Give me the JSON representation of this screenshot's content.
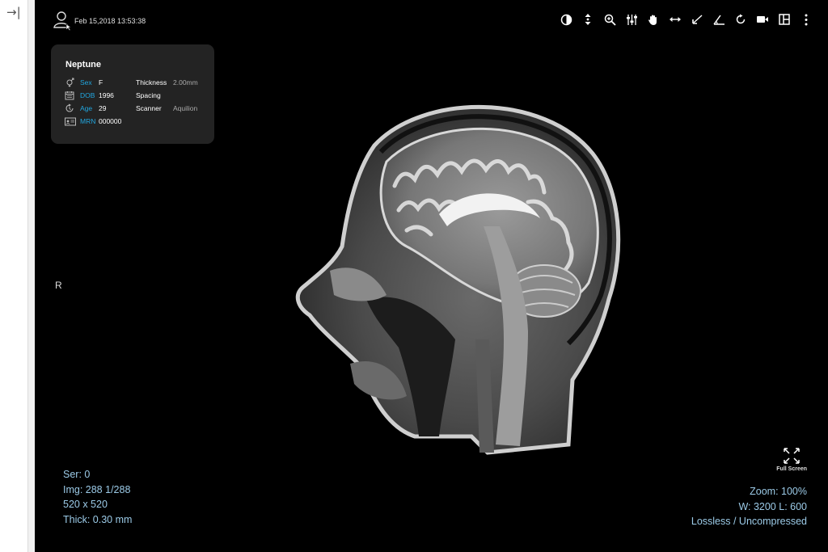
{
  "sidebar": {
    "expand_icon": "→|"
  },
  "header": {
    "datetime": "Feb 15,2018 13:53:38"
  },
  "toolbar": {
    "tools": [
      "contrast-icon",
      "scroll-icon",
      "zoom-icon",
      "adjust-icon",
      "pan-icon",
      "length-icon",
      "angle-icon",
      "measure-icon",
      "rotate-icon",
      "video-icon",
      "layout-icon",
      "more-icon"
    ]
  },
  "patient": {
    "name": "Neptune",
    "sex_label": "Sex",
    "sex": "F",
    "dob_label": "DOB",
    "dob": "1996",
    "age_label": "Age",
    "age": "29",
    "mrn_label": "MRN",
    "mrn": "000000",
    "thickness_label": "Thickness",
    "thickness": "2.00mm",
    "spacing_label": "Spacing",
    "spacing": "",
    "scanner_label": "Scanner",
    "scanner": "Aquilion"
  },
  "viewer": {
    "orientation": "R",
    "series": "Ser: 0",
    "image": "Img: 288 1/288",
    "size": "520 x 520",
    "thick": "Thick: 0.30 mm",
    "zoom": "Zoom: 100%",
    "window": "W: 3200 L: 600",
    "compression": "Lossless / Uncompressed",
    "fullscreen_label": "Full Screen"
  },
  "colors": {
    "accent": "#21a7e0",
    "overlay_text": "#9ccbe8",
    "panel": "#232323"
  }
}
